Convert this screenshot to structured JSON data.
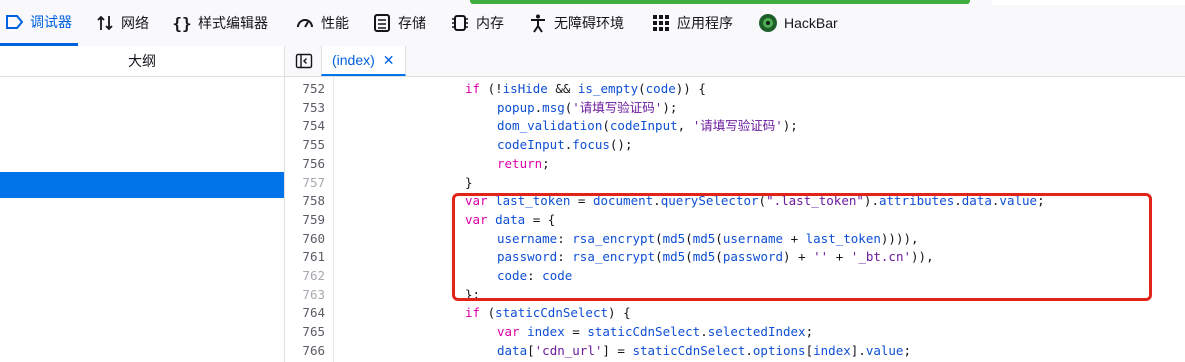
{
  "toolbar": {
    "tabs": [
      {
        "label": "调试器",
        "icon": "debugger-icon"
      },
      {
        "label": "网络",
        "icon": "network-arrows-icon"
      },
      {
        "label": "样式编辑器",
        "icon": "braces-icon"
      },
      {
        "label": "性能",
        "icon": "gauge-icon"
      },
      {
        "label": "存储",
        "icon": "storage-icon"
      },
      {
        "label": "内存",
        "icon": "memory-chip-icon"
      },
      {
        "label": "无障碍环境",
        "icon": "accessibility-icon"
      },
      {
        "label": "应用程序",
        "icon": "grid-icon"
      },
      {
        "label": "HackBar",
        "icon": "hackbar-logo-icon"
      }
    ],
    "active_tab": "调试器",
    "colors": {
      "active": "#0061e0",
      "strip": "#3fae3f"
    }
  },
  "outline": {
    "title": "大纲"
  },
  "editor": {
    "source_tab": "(index)",
    "close_glyph": "✕",
    "lines": [
      {
        "n": "752",
        "dim": false,
        "indent": 0,
        "segs": [
          [
            "kw",
            "if"
          ],
          [
            "plain",
            " (!"
          ],
          [
            "id",
            "isHide"
          ],
          [
            "plain",
            " && "
          ],
          [
            "id",
            "is_empty"
          ],
          [
            "plain",
            "("
          ],
          [
            "id",
            "code"
          ],
          [
            "plain",
            ")) {"
          ]
        ]
      },
      {
        "n": "753",
        "dim": false,
        "indent": 1,
        "segs": [
          [
            "id",
            "popup"
          ],
          [
            "plain",
            "."
          ],
          [
            "prop",
            "msg"
          ],
          [
            "plain",
            "("
          ],
          [
            "str",
            "'请填写验证码'"
          ],
          [
            "plain",
            ");"
          ]
        ]
      },
      {
        "n": "754",
        "dim": false,
        "indent": 1,
        "segs": [
          [
            "id",
            "dom_validation"
          ],
          [
            "plain",
            "("
          ],
          [
            "id",
            "codeInput"
          ],
          [
            "plain",
            ", "
          ],
          [
            "str",
            "'请填写验证码'"
          ],
          [
            "plain",
            ");"
          ]
        ]
      },
      {
        "n": "755",
        "dim": false,
        "indent": 1,
        "segs": [
          [
            "id",
            "codeInput"
          ],
          [
            "plain",
            "."
          ],
          [
            "prop",
            "focus"
          ],
          [
            "plain",
            "();"
          ]
        ]
      },
      {
        "n": "756",
        "dim": false,
        "indent": 1,
        "segs": [
          [
            "kw",
            "return"
          ],
          [
            "plain",
            ";"
          ]
        ]
      },
      {
        "n": "757",
        "dim": true,
        "indent": 0,
        "segs": [
          [
            "plain",
            "}"
          ]
        ]
      },
      {
        "n": "758",
        "dim": false,
        "indent": 0,
        "segs": [
          [
            "kw",
            "var"
          ],
          [
            "plain",
            " "
          ],
          [
            "id",
            "last_token"
          ],
          [
            "plain",
            " = "
          ],
          [
            "id",
            "document"
          ],
          [
            "plain",
            "."
          ],
          [
            "prop",
            "querySelector"
          ],
          [
            "plain",
            "("
          ],
          [
            "str",
            "\".last_token\""
          ],
          [
            "plain",
            ")."
          ],
          [
            "prop",
            "attributes"
          ],
          [
            "plain",
            "."
          ],
          [
            "prop",
            "data"
          ],
          [
            "plain",
            "."
          ],
          [
            "prop",
            "value"
          ],
          [
            "plain",
            ";"
          ]
        ]
      },
      {
        "n": "759",
        "dim": false,
        "indent": 0,
        "segs": [
          [
            "kw",
            "var"
          ],
          [
            "plain",
            " "
          ],
          [
            "id",
            "data"
          ],
          [
            "plain",
            " = {"
          ]
        ]
      },
      {
        "n": "760",
        "dim": false,
        "indent": 1,
        "segs": [
          [
            "prop",
            "username"
          ],
          [
            "plain",
            ": "
          ],
          [
            "id",
            "rsa_encrypt"
          ],
          [
            "plain",
            "("
          ],
          [
            "id",
            "md5"
          ],
          [
            "plain",
            "("
          ],
          [
            "id",
            "md5"
          ],
          [
            "plain",
            "("
          ],
          [
            "id",
            "username"
          ],
          [
            "plain",
            " + "
          ],
          [
            "id",
            "last_token"
          ],
          [
            "plain",
            ")))),"
          ]
        ]
      },
      {
        "n": "761",
        "dim": false,
        "indent": 1,
        "segs": [
          [
            "prop",
            "password"
          ],
          [
            "plain",
            ": "
          ],
          [
            "id",
            "rsa_encrypt"
          ],
          [
            "plain",
            "("
          ],
          [
            "id",
            "md5"
          ],
          [
            "plain",
            "("
          ],
          [
            "id",
            "md5"
          ],
          [
            "plain",
            "("
          ],
          [
            "id",
            "password"
          ],
          [
            "plain",
            ") + "
          ],
          [
            "str",
            "''"
          ],
          [
            "plain",
            " + "
          ],
          [
            "str",
            "'_bt.cn'"
          ],
          [
            "plain",
            ")),"
          ]
        ]
      },
      {
        "n": "762",
        "dim": true,
        "indent": 1,
        "segs": [
          [
            "prop",
            "code"
          ],
          [
            "plain",
            ": "
          ],
          [
            "id",
            "code"
          ]
        ]
      },
      {
        "n": "763",
        "dim": true,
        "indent": 0,
        "segs": [
          [
            "plain",
            "};"
          ]
        ]
      },
      {
        "n": "764",
        "dim": false,
        "indent": 0,
        "segs": [
          [
            "kw",
            "if"
          ],
          [
            "plain",
            " ("
          ],
          [
            "id",
            "staticCdnSelect"
          ],
          [
            "plain",
            ") {"
          ]
        ]
      },
      {
        "n": "765",
        "dim": false,
        "indent": 1,
        "segs": [
          [
            "kw",
            "var"
          ],
          [
            "plain",
            " "
          ],
          [
            "id",
            "index"
          ],
          [
            "plain",
            " = "
          ],
          [
            "id",
            "staticCdnSelect"
          ],
          [
            "plain",
            "."
          ],
          [
            "prop",
            "selectedIndex"
          ],
          [
            "plain",
            ";"
          ]
        ]
      },
      {
        "n": "766",
        "dim": false,
        "indent": 1,
        "segs": [
          [
            "id",
            "data"
          ],
          [
            "plain",
            "["
          ],
          [
            "str",
            "'cdn_url'"
          ],
          [
            "plain",
            "] = "
          ],
          [
            "id",
            "staticCdnSelect"
          ],
          [
            "plain",
            "."
          ],
          [
            "prop",
            "options"
          ],
          [
            "plain",
            "["
          ],
          [
            "id",
            "index"
          ],
          [
            "plain",
            "]."
          ],
          [
            "prop",
            "value"
          ],
          [
            "plain",
            ";"
          ]
        ]
      }
    ]
  }
}
